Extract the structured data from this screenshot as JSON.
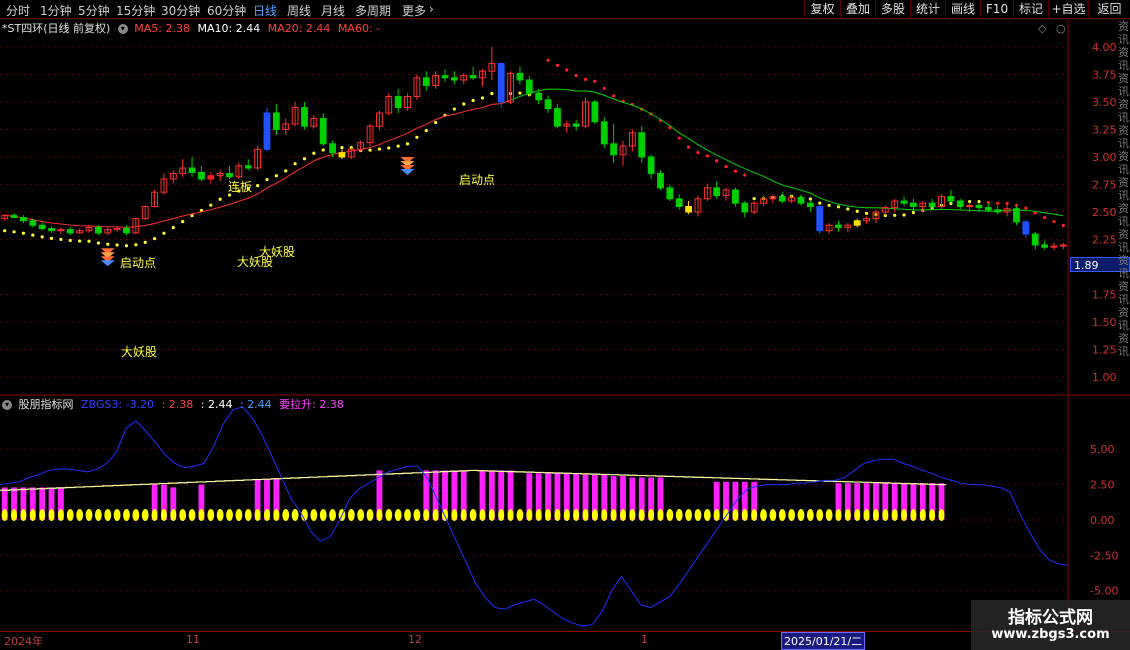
{
  "toolbar": {
    "periods": [
      "分时",
      "1分钟",
      "5分钟",
      "15分钟",
      "30分钟",
      "60分钟",
      "日线",
      "周线",
      "月线",
      "多周期",
      "更多"
    ],
    "active_period": "日线",
    "more_arrow": "›",
    "buttons": [
      "复权",
      "叠加",
      "多股",
      "统计",
      "画线",
      "F10",
      "标记",
      "+自选",
      "返回"
    ]
  },
  "main_legend": {
    "title": "*ST四环(日线 前复权)",
    "ma5": "MA5: 2.38",
    "ma10": "MA10: 2.44",
    "ma20": "MA20: 2.44",
    "ma60": "MA60: -"
  },
  "indicator_legend": {
    "name": "股朋指标网",
    "zbgs3": "ZBGS3: -3.20",
    "v1": ": 2.38",
    "v2": ": 2.44",
    "v3": ": 2.44",
    "yaolasheng": "要拉升: 2.38"
  },
  "price_axis": [
    "4.00",
    "3.75",
    "3.50",
    "3.25",
    "3.00",
    "2.75",
    "2.50",
    "2.25",
    "1.75",
    "1.50",
    "1.25",
    "1.00"
  ],
  "indicator_axis": [
    "5.00",
    "2.50",
    "0.00",
    "-2.50",
    "-5.00"
  ],
  "current_price": "1.89",
  "annotations": {
    "qidongdian_1": "启动点",
    "qidongdian_2": "启动点",
    "lianban": "连板",
    "dayaogu_1": "大妖股",
    "dayaogu_2": "大妖股",
    "dayaogu_3": "大妖股"
  },
  "dates": {
    "year": "2024年",
    "nov": "11",
    "dec": "12",
    "jan": "1",
    "selected": "2025/01/21/二"
  },
  "watermark": {
    "title": "指标公式网",
    "url": "www.zbgs3.com"
  },
  "side_strip_text": "资讯资讯资讯资讯资讯资讯资讯资讯资讯资讯资讯资讯资讯",
  "colors": {
    "up": "#ff3030",
    "down": "#00d000",
    "ma_red": "#ff3030",
    "ma_green": "#00d000",
    "dots_yellow": "#ffff30",
    "zbgs3": "#2030ff",
    "magenta": "#ff20ff",
    "yellow": "#ffff00"
  },
  "chart_data": {
    "type": "candlestick",
    "price_range": [
      0.9,
      4.1
    ],
    "candles": [
      [
        2.44,
        2.48,
        2.42,
        2.47
      ],
      [
        2.47,
        2.49,
        2.44,
        2.45
      ],
      [
        2.45,
        2.47,
        2.4,
        2.42
      ],
      [
        2.42,
        2.44,
        2.36,
        2.38
      ],
      [
        2.38,
        2.41,
        2.33,
        2.35
      ],
      [
        2.35,
        2.37,
        2.31,
        2.33
      ],
      [
        2.33,
        2.36,
        2.3,
        2.34
      ],
      [
        2.34,
        2.36,
        2.29,
        2.31
      ],
      [
        2.31,
        2.35,
        2.3,
        2.33
      ],
      [
        2.33,
        2.38,
        2.31,
        2.36
      ],
      [
        2.36,
        2.38,
        2.29,
        2.31
      ],
      [
        2.31,
        2.36,
        2.29,
        2.34
      ],
      [
        2.34,
        2.37,
        2.32,
        2.35
      ],
      [
        2.35,
        2.38,
        2.29,
        2.31
      ],
      [
        2.31,
        2.45,
        2.3,
        2.44
      ],
      [
        2.44,
        2.56,
        2.43,
        2.55
      ],
      [
        2.55,
        2.7,
        2.54,
        2.68
      ],
      [
        2.68,
        2.85,
        2.66,
        2.8
      ],
      [
        2.8,
        2.88,
        2.76,
        2.85
      ],
      [
        2.85,
        2.98,
        2.82,
        2.9
      ],
      [
        2.9,
        3.0,
        2.82,
        2.86
      ],
      [
        2.86,
        2.92,
        2.78,
        2.8
      ],
      [
        2.8,
        2.86,
        2.76,
        2.83
      ],
      [
        2.83,
        2.88,
        2.78,
        2.85
      ],
      [
        2.85,
        2.92,
        2.8,
        2.82
      ],
      [
        2.82,
        2.95,
        2.8,
        2.92
      ],
      [
        2.92,
        2.98,
        2.88,
        2.9
      ],
      [
        2.9,
        3.1,
        2.88,
        3.07
      ],
      [
        3.07,
        3.45,
        3.05,
        3.4
      ],
      [
        3.4,
        3.48,
        3.2,
        3.25
      ],
      [
        3.25,
        3.35,
        3.2,
        3.3
      ],
      [
        3.3,
        3.5,
        3.28,
        3.45
      ],
      [
        3.45,
        3.5,
        3.25,
        3.28
      ],
      [
        3.28,
        3.38,
        3.26,
        3.35
      ],
      [
        3.35,
        3.4,
        3.1,
        3.12
      ],
      [
        3.12,
        3.15,
        3.0,
        3.04
      ],
      [
        3.04,
        3.08,
        2.98,
        3.0
      ],
      [
        3.0,
        3.08,
        2.98,
        3.07
      ],
      [
        3.07,
        3.15,
        3.05,
        3.13
      ],
      [
        3.13,
        3.3,
        3.1,
        3.28
      ],
      [
        3.28,
        3.42,
        3.25,
        3.4
      ],
      [
        3.4,
        3.58,
        3.38,
        3.55
      ],
      [
        3.55,
        3.62,
        3.4,
        3.45
      ],
      [
        3.45,
        3.58,
        3.42,
        3.55
      ],
      [
        3.55,
        3.75,
        3.52,
        3.72
      ],
      [
        3.72,
        3.78,
        3.6,
        3.65
      ],
      [
        3.65,
        3.78,
        3.62,
        3.74
      ],
      [
        3.74,
        3.8,
        3.68,
        3.72
      ],
      [
        3.72,
        3.78,
        3.66,
        3.7
      ],
      [
        3.7,
        3.76,
        3.66,
        3.74
      ],
      [
        3.74,
        3.82,
        3.7,
        3.72
      ],
      [
        3.72,
        3.8,
        3.64,
        3.78
      ],
      [
        3.78,
        4.0,
        3.7,
        3.85
      ],
      [
        3.85,
        3.7,
        3.45,
        3.5
      ],
      [
        3.5,
        3.78,
        3.48,
        3.76
      ],
      [
        3.76,
        3.82,
        3.66,
        3.7
      ],
      [
        3.7,
        3.74,
        3.55,
        3.58
      ],
      [
        3.58,
        3.62,
        3.48,
        3.52
      ],
      [
        3.52,
        3.56,
        3.4,
        3.44
      ],
      [
        3.44,
        3.48,
        3.26,
        3.28
      ],
      [
        3.28,
        3.33,
        3.22,
        3.3
      ],
      [
        3.3,
        3.34,
        3.24,
        3.28
      ],
      [
        3.28,
        3.54,
        3.26,
        3.5
      ],
      [
        3.5,
        3.52,
        3.3,
        3.32
      ],
      [
        3.32,
        3.36,
        3.08,
        3.12
      ],
      [
        3.12,
        3.3,
        2.95,
        3.02
      ],
      [
        3.02,
        3.15,
        2.92,
        3.1
      ],
      [
        3.1,
        3.25,
        3.05,
        3.22
      ],
      [
        3.22,
        3.28,
        2.95,
        3.0
      ],
      [
        3.0,
        3.02,
        2.8,
        2.85
      ],
      [
        2.85,
        2.88,
        2.7,
        2.72
      ],
      [
        2.72,
        2.75,
        2.6,
        2.62
      ],
      [
        2.62,
        2.66,
        2.52,
        2.55
      ],
      [
        2.55,
        2.6,
        2.48,
        2.5
      ],
      [
        2.5,
        2.65,
        2.46,
        2.62
      ],
      [
        2.62,
        2.76,
        2.6,
        2.72
      ],
      [
        2.72,
        2.78,
        2.62,
        2.65
      ],
      [
        2.65,
        2.72,
        2.6,
        2.7
      ],
      [
        2.7,
        2.72,
        2.55,
        2.58
      ],
      [
        2.58,
        2.6,
        2.45,
        2.5
      ],
      [
        2.5,
        2.6,
        2.48,
        2.58
      ],
      [
        2.58,
        2.65,
        2.55,
        2.62
      ],
      [
        2.62,
        2.66,
        2.58,
        2.64
      ],
      [
        2.64,
        2.68,
        2.58,
        2.6
      ],
      [
        2.6,
        2.65,
        2.58,
        2.63
      ],
      [
        2.63,
        2.66,
        2.56,
        2.58
      ],
      [
        2.58,
        2.6,
        2.5,
        2.55
      ],
      [
        2.55,
        2.56,
        2.3,
        2.33
      ],
      [
        2.33,
        2.4,
        2.3,
        2.38
      ],
      [
        2.38,
        2.42,
        2.32,
        2.36
      ],
      [
        2.36,
        2.4,
        2.32,
        2.38
      ],
      [
        2.38,
        2.44,
        2.36,
        2.42
      ],
      [
        2.42,
        2.46,
        2.39,
        2.44
      ],
      [
        2.44,
        2.52,
        2.4,
        2.5
      ],
      [
        2.5,
        2.56,
        2.47,
        2.54
      ],
      [
        2.54,
        2.62,
        2.5,
        2.6
      ],
      [
        2.6,
        2.64,
        2.55,
        2.58
      ],
      [
        2.58,
        2.62,
        2.52,
        2.55
      ],
      [
        2.55,
        2.6,
        2.5,
        2.58
      ],
      [
        2.58,
        2.62,
        2.52,
        2.55
      ],
      [
        2.55,
        2.66,
        2.53,
        2.64
      ],
      [
        2.64,
        2.7,
        2.58,
        2.6
      ],
      [
        2.6,
        2.62,
        2.52,
        2.55
      ],
      [
        2.55,
        2.58,
        2.5,
        2.56
      ],
      [
        2.56,
        2.58,
        2.5,
        2.54
      ],
      [
        2.54,
        2.58,
        2.5,
        2.52
      ],
      [
        2.52,
        2.56,
        2.48,
        2.5
      ],
      [
        2.5,
        2.56,
        2.46,
        2.53
      ],
      [
        2.53,
        2.55,
        2.38,
        2.41
      ],
      [
        2.41,
        2.43,
        2.26,
        2.3
      ],
      [
        2.3,
        2.32,
        2.16,
        2.2
      ],
      [
        2.2,
        2.24,
        2.16,
        2.18
      ],
      [
        2.18,
        2.22,
        2.15,
        2.19
      ],
      [
        2.19,
        2.22,
        2.16,
        2.2
      ]
    ],
    "special_candles": {
      "blue": [
        28,
        53,
        87,
        109
      ],
      "yellow": [
        36,
        73,
        91
      ],
      "red_big": [
        22
      ]
    },
    "indicator": {
      "range": [
        -7.5,
        8.2
      ],
      "magenta_bars": [
        2.3,
        2.3,
        2.3,
        2.3,
        2.3,
        2.3,
        2.3,
        0,
        0,
        0,
        0,
        0,
        0,
        0,
        0,
        0,
        2.5,
        2.5,
        2.3,
        0,
        0,
        2.5,
        0,
        0,
        0,
        0,
        0,
        2.9,
        2.9,
        2.9,
        0,
        0,
        0,
        0,
        0,
        0,
        0,
        0,
        0,
        0,
        3.5,
        0,
        0,
        0,
        0,
        3.5,
        3.5,
        3.5,
        3.5,
        3.5,
        0,
        3.5,
        3.5,
        3.5,
        3.5,
        0,
        3.3,
        3.3,
        3.3,
        3.3,
        3.3,
        3.3,
        3.2,
        3.2,
        3.2,
        3.1,
        3.1,
        3.0,
        3.0,
        3.0,
        3.0,
        0,
        0,
        0,
        0,
        0,
        2.7,
        2.7,
        2.7,
        2.7,
        2.7,
        0,
        0,
        0,
        0,
        0,
        0,
        0,
        0,
        2.6,
        2.6,
        2.6,
        2.6,
        2.6,
        2.6,
        2.6,
        2.6,
        2.6,
        2.6,
        2.6,
        2.6
      ]
    }
  }
}
